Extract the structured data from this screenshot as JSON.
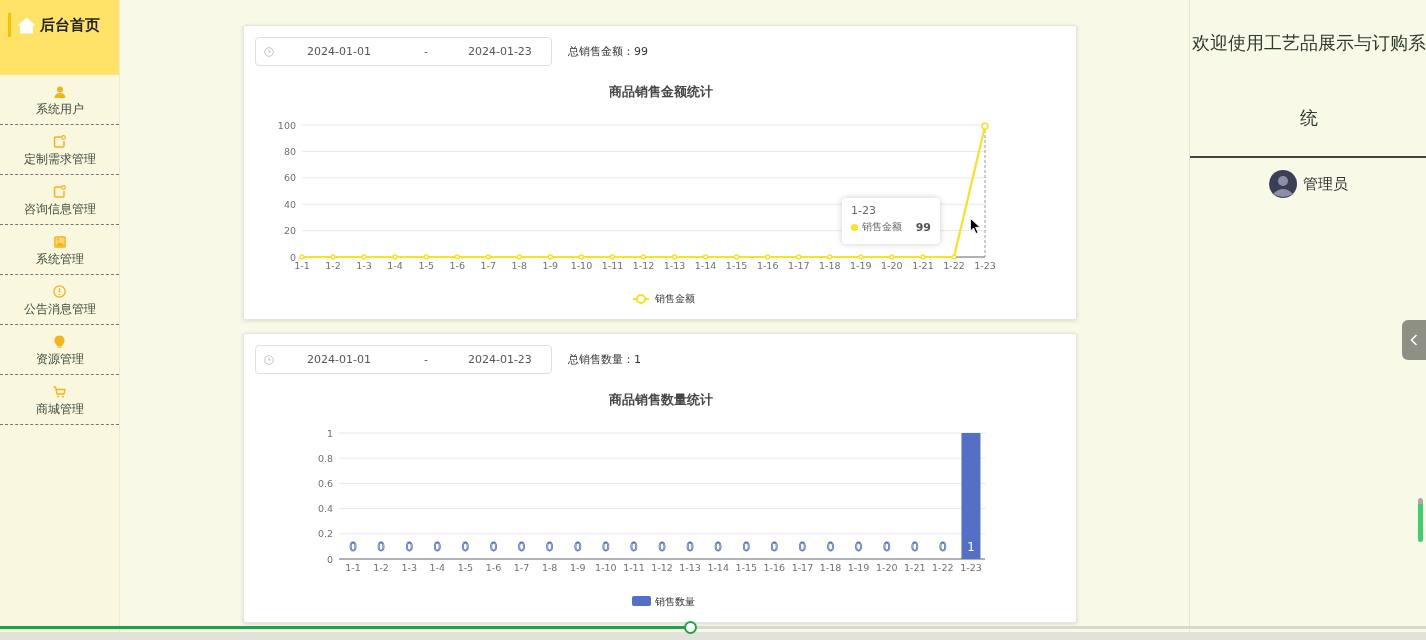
{
  "sidebar": {
    "home": {
      "label": "后台首页"
    },
    "items": [
      {
        "label": "系统用户",
        "kind": "user"
      },
      {
        "label": "定制需求管理",
        "kind": "note"
      },
      {
        "label": "咨询信息管理",
        "kind": "note"
      },
      {
        "label": "系统管理",
        "kind": "image"
      },
      {
        "label": "公告消息管理",
        "kind": "info"
      },
      {
        "label": "资源管理",
        "kind": "bulb"
      },
      {
        "label": "商城管理",
        "kind": "cart"
      }
    ]
  },
  "charts": [
    {
      "filter": {
        "start": "2024-01-01",
        "separator": "-",
        "end": "2024-01-23"
      },
      "summary": "总销售金额：99",
      "chart_data": {
        "type": "line",
        "title": "商品销售金额统计",
        "categories": [
          "1-1",
          "1-2",
          "1-3",
          "1-4",
          "1-5",
          "1-6",
          "1-7",
          "1-8",
          "1-9",
          "1-10",
          "1-11",
          "1-12",
          "1-13",
          "1-14",
          "1-15",
          "1-16",
          "1-17",
          "1-18",
          "1-19",
          "1-20",
          "1-21",
          "1-22",
          "1-23"
        ],
        "series": [
          {
            "name": "销售金额",
            "color": "#f7e31f",
            "values": [
              0,
              0,
              0,
              0,
              0,
              0,
              0,
              0,
              0,
              0,
              0,
              0,
              0,
              0,
              0,
              0,
              0,
              0,
              0,
              0,
              0,
              0,
              99
            ]
          }
        ],
        "ylim": [
          0,
          100
        ],
        "yticks": [
          0,
          20,
          40,
          60,
          80,
          100
        ],
        "grid": true,
        "marker": true
      },
      "tooltip": {
        "title": "1-23",
        "series": "销售金额",
        "value": "99"
      }
    },
    {
      "filter": {
        "start": "2024-01-01",
        "separator": "-",
        "end": "2024-01-23"
      },
      "summary": "总销售数量：1",
      "chart_data": {
        "type": "bar",
        "title": "商品销售数量统计",
        "categories": [
          "1-1",
          "1-2",
          "1-3",
          "1-4",
          "1-5",
          "1-6",
          "1-7",
          "1-8",
          "1-9",
          "1-10",
          "1-11",
          "1-12",
          "1-13",
          "1-14",
          "1-15",
          "1-16",
          "1-17",
          "1-18",
          "1-19",
          "1-20",
          "1-21",
          "1-22",
          "1-23"
        ],
        "series": [
          {
            "name": "销售数量",
            "color": "#5470c6",
            "values": [
              0,
              0,
              0,
              0,
              0,
              0,
              0,
              0,
              0,
              0,
              0,
              0,
              0,
              0,
              0,
              0,
              0,
              0,
              0,
              0,
              0,
              0,
              1
            ]
          }
        ],
        "ylim": [
          0,
          1
        ],
        "yticks": [
          0,
          0.2,
          0.4,
          0.6,
          0.8,
          1
        ],
        "grid": true,
        "data_labels": true
      }
    }
  ],
  "welcome": {
    "title": "欢迎使用工艺品展示与订购系统",
    "user": "管理员"
  },
  "player": {
    "level": 0.484
  }
}
